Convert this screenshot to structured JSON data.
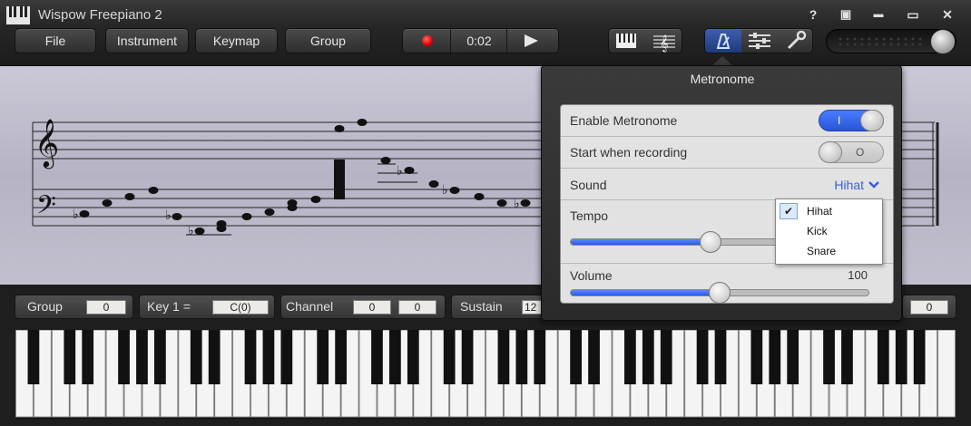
{
  "window": {
    "title": "Wispow Freepiano 2"
  },
  "window_controls": {
    "help": "?",
    "mini": "▣",
    "minimize": "▬",
    "maximize": "▭",
    "close": "✕"
  },
  "menu": {
    "file": "File",
    "instrument": "Instrument",
    "keymap": "Keymap",
    "group": "Group"
  },
  "transport": {
    "time": "0:02"
  },
  "controls": {
    "group_label": "Group",
    "group_value": "0",
    "key_label": "Key  1 =",
    "key_value": "C(0)",
    "channel_label": "Channel",
    "channel_value_1": "0",
    "channel_value_2": "0",
    "sustain_label": "Sustain",
    "sustain_value": "12",
    "right_value": "0"
  },
  "metronome": {
    "title": "Metronome",
    "enable_label": "Enable Metronome",
    "enable_state": "I",
    "record_label": "Start when recording",
    "record_state": "O",
    "sound_label": "Sound",
    "sound_value": "Hihat",
    "tempo_label": "Tempo",
    "volume_label": "Volume",
    "volume_value": "100",
    "tempo_fraction": 0.47,
    "volume_fraction": 0.5,
    "sound_options": [
      "Hihat",
      "Kick",
      "Snare"
    ]
  },
  "icons": {
    "app": "piano-keys-icon",
    "record": "record-icon",
    "play": "play-icon",
    "keyboard_view": "keyboard-icon",
    "score_view": "score-icon",
    "metronome": "metronome-icon",
    "mixer": "sliders-icon",
    "settings": "wrench-icon",
    "dropdown": "chevron-down-icon",
    "check": "check-icon"
  },
  "colors": {
    "accent": "#2855d8",
    "record": "#dd0000",
    "score_bg": "#c2bfcf"
  }
}
